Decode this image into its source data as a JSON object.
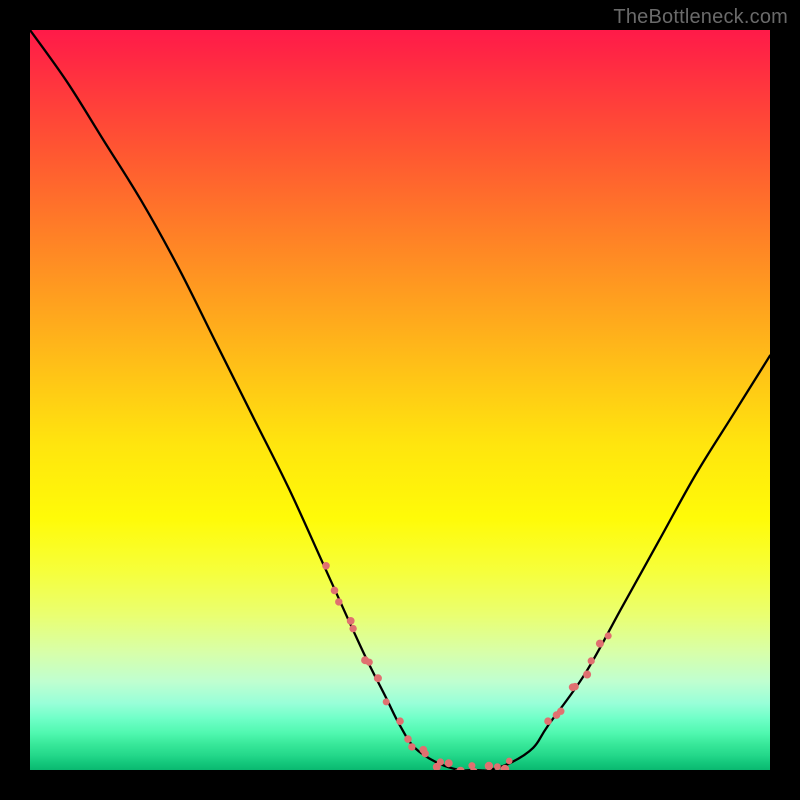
{
  "watermark": "TheBottleneck.com",
  "chart_data": {
    "type": "line",
    "title": "",
    "xlabel": "",
    "ylabel": "",
    "xlim": [
      0,
      100
    ],
    "ylim": [
      0,
      100
    ],
    "grid": false,
    "series": [
      {
        "name": "bottleneck-curve",
        "color": "#000000",
        "x": [
          0,
          5,
          10,
          15,
          20,
          25,
          30,
          35,
          40,
          45,
          48,
          50,
          52,
          55,
          58,
          60,
          62,
          65,
          68,
          70,
          75,
          80,
          85,
          90,
          95,
          100
        ],
        "y": [
          100,
          93,
          85,
          77,
          68,
          58,
          48,
          38,
          27,
          16,
          10,
          6,
          3,
          1,
          0,
          0,
          0,
          1,
          3,
          6,
          13,
          22,
          31,
          40,
          48,
          56
        ]
      }
    ],
    "annotations": [
      {
        "name": "marker-cluster-left",
        "type": "markers",
        "color": "#e07070",
        "x_range": [
          40,
          48
        ],
        "y_range": [
          10,
          27
        ]
      },
      {
        "name": "marker-cluster-bottom",
        "type": "markers",
        "color": "#e07070",
        "x_range": [
          50,
          65
        ],
        "y_range": [
          0,
          3
        ]
      },
      {
        "name": "marker-cluster-right",
        "type": "markers",
        "color": "#e07070",
        "x_range": [
          70,
          78
        ],
        "y_range": [
          6,
          20
        ]
      }
    ]
  }
}
